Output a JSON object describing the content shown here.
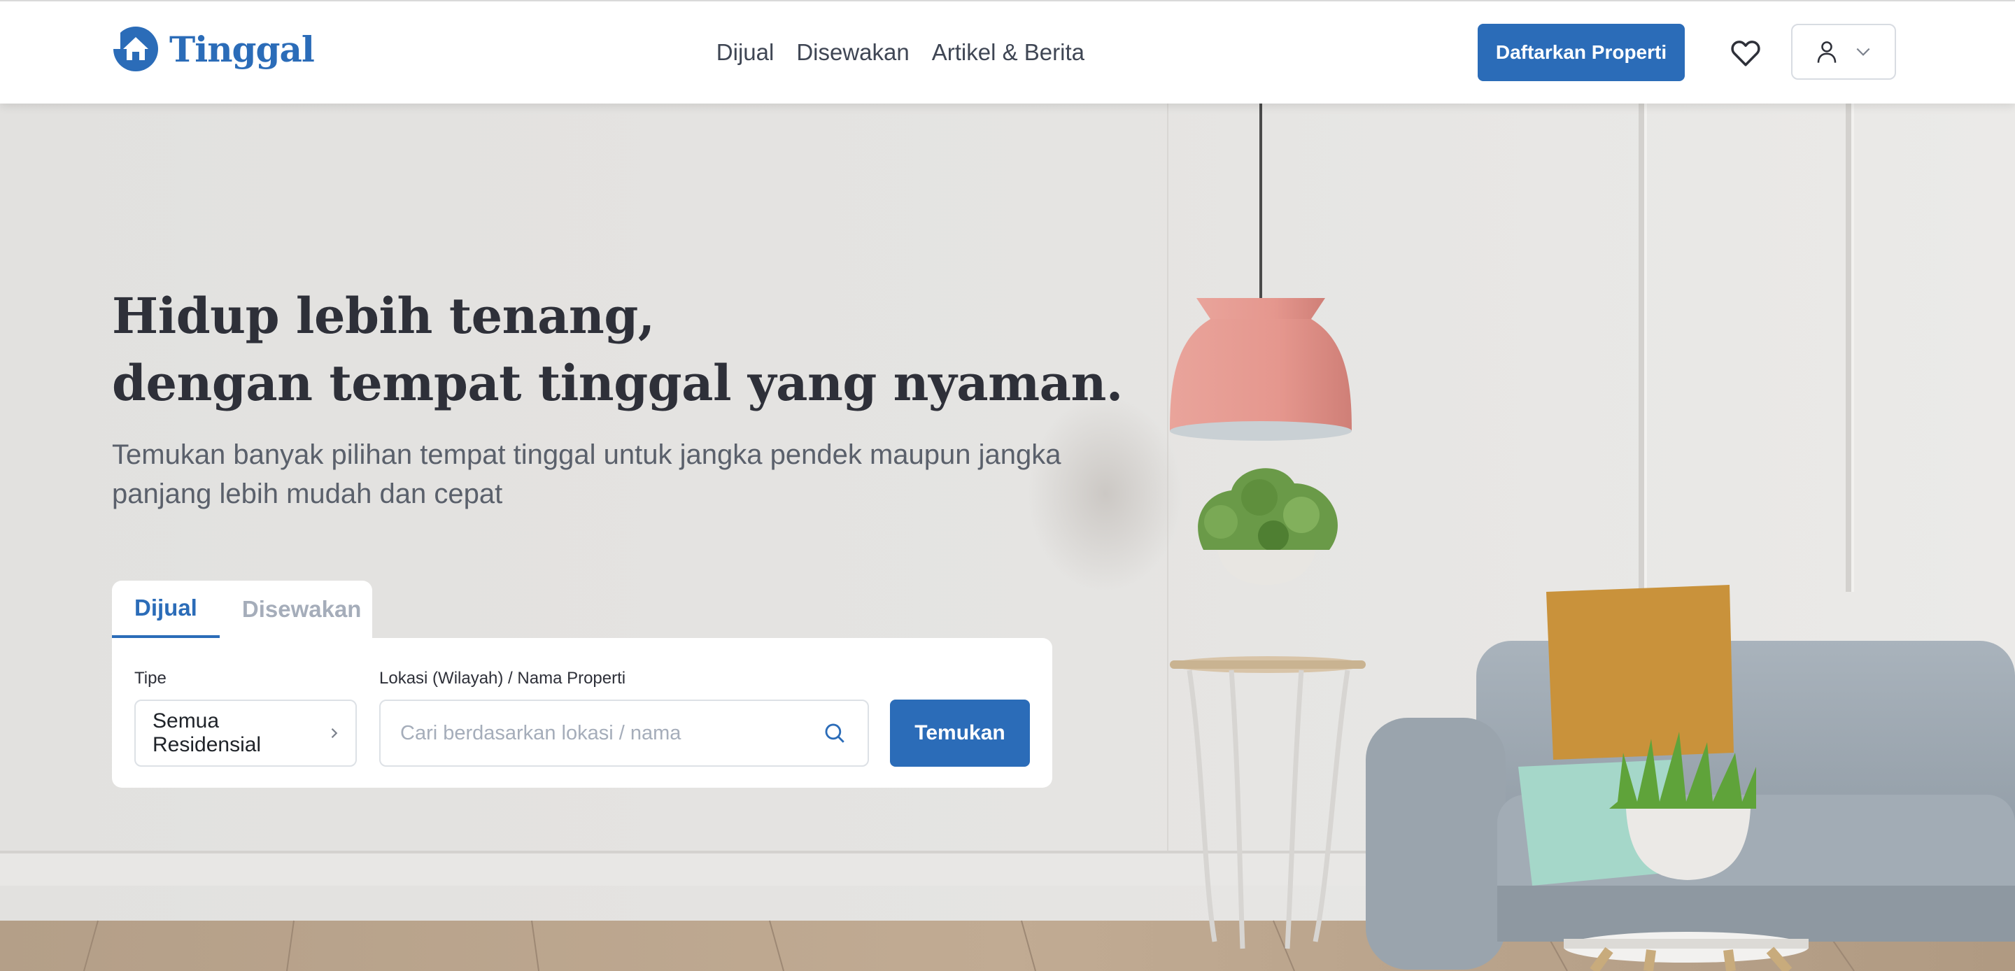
{
  "brand": {
    "name": "Tinggal",
    "accent": "#2b6cb8"
  },
  "nav": {
    "links": [
      "Dijual",
      "Disewakan",
      "Artikel & Berita"
    ],
    "cta_label": "Daftarkan Properti",
    "icons": [
      "heart-icon",
      "user-icon",
      "chevron-down-icon"
    ]
  },
  "hero": {
    "headline_line1": "Hidup lebih tenang,",
    "headline_line2": "dengan tempat tinggal yang nyaman.",
    "subtitle": "Temukan banyak pilihan tempat tinggal untuk jangka pendek maupun jangka panjang lebih mudah dan cepat"
  },
  "search": {
    "tabs": [
      {
        "label": "Dijual",
        "active": true
      },
      {
        "label": "Disewakan",
        "active": false
      }
    ],
    "type_label": "Tipe",
    "type_value": "Semua Residensial",
    "location_label": "Lokasi (Wilayah) / Nama Properti",
    "location_placeholder": "Cari berdasarkan lokasi / nama",
    "location_value": "",
    "submit_label": "Temukan"
  }
}
